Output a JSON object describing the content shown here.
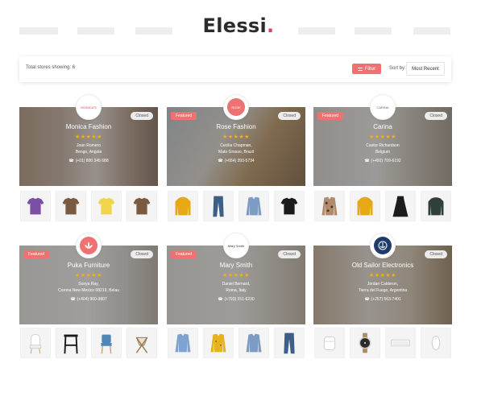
{
  "brand": {
    "name": "Elessi",
    "dot": "."
  },
  "toolbar": {
    "total_label": "Total stores showing: 6",
    "filter_label": "Filter",
    "sortby_label": "Sort by:",
    "sort_value": "Most Recent"
  },
  "colors": {
    "accent": "#f07171",
    "star": "#f5b300"
  },
  "stores": [
    {
      "featured": "",
      "status": "Closed",
      "name": "Monica Fashion",
      "stars": "★★★★★",
      "addr1": "Joan Romero",
      "addr2": "Bengo, Angola",
      "phone": "(+01) 800 345 688",
      "logo_text": "MONICA'S",
      "products": [
        "tshirt-purple",
        "tshirt-brown",
        "tshirt-yellow",
        "tshirt-brown"
      ]
    },
    {
      "featured": "Featured",
      "status": "Closed",
      "name": "Rose Fashion",
      "stars": "★★★★★",
      "addr1": "Cecilia Chapman,",
      "addr2": "Mato Grosso, Brazil",
      "phone": "(+654) 393-5734",
      "logo_text": "ROSE",
      "products": [
        "hoodie-yellow",
        "jeans-blue",
        "shirt-denim",
        "tshirt-black"
      ]
    },
    {
      "featured": "Featured",
      "status": "Closed",
      "name": "Carina",
      "stars": "★★★★★",
      "addr1": "Castor Richardson",
      "addr2": "Belgium",
      "phone": "(+492) 709-6192",
      "logo_text": "CARINA",
      "products": [
        "jacket-pattern",
        "hoodie-yellow",
        "dress-black",
        "sweater-green"
      ]
    },
    {
      "featured": "Featured",
      "status": "Closed",
      "name": "Puka Furniture",
      "stars": "★★★★★",
      "addr1": "Sonya Ray,",
      "addr2": "Corona New Mexico 08219, Belau",
      "phone": "(+404) 960-3807",
      "logo_text": "",
      "products": [
        "chair-white",
        "stool-black",
        "chair-blue",
        "chair-folding"
      ]
    },
    {
      "featured": "Featured",
      "status": "Closed",
      "name": "Mary Smith",
      "stars": "★★★★★",
      "addr1": "Daniel Bernard,",
      "addr2": "Roma, Italy",
      "phone": "(+793) 151-6230",
      "logo_text": "Mary Smith",
      "products": [
        "shirt-blue",
        "shirt-yellow",
        "shirt-denim",
        "jeans-blue"
      ]
    },
    {
      "featured": "",
      "status": "Closed",
      "name": "Old Sailor Electronics",
      "stars": "★★★★★",
      "addr1": "Jordan Calderon,",
      "addr2": "Tierra del Fuego, Argentina",
      "phone": "(+257) 563-7401",
      "logo_text": "",
      "products": [
        "airpods",
        "watch",
        "keyboard",
        "mouse"
      ]
    }
  ]
}
